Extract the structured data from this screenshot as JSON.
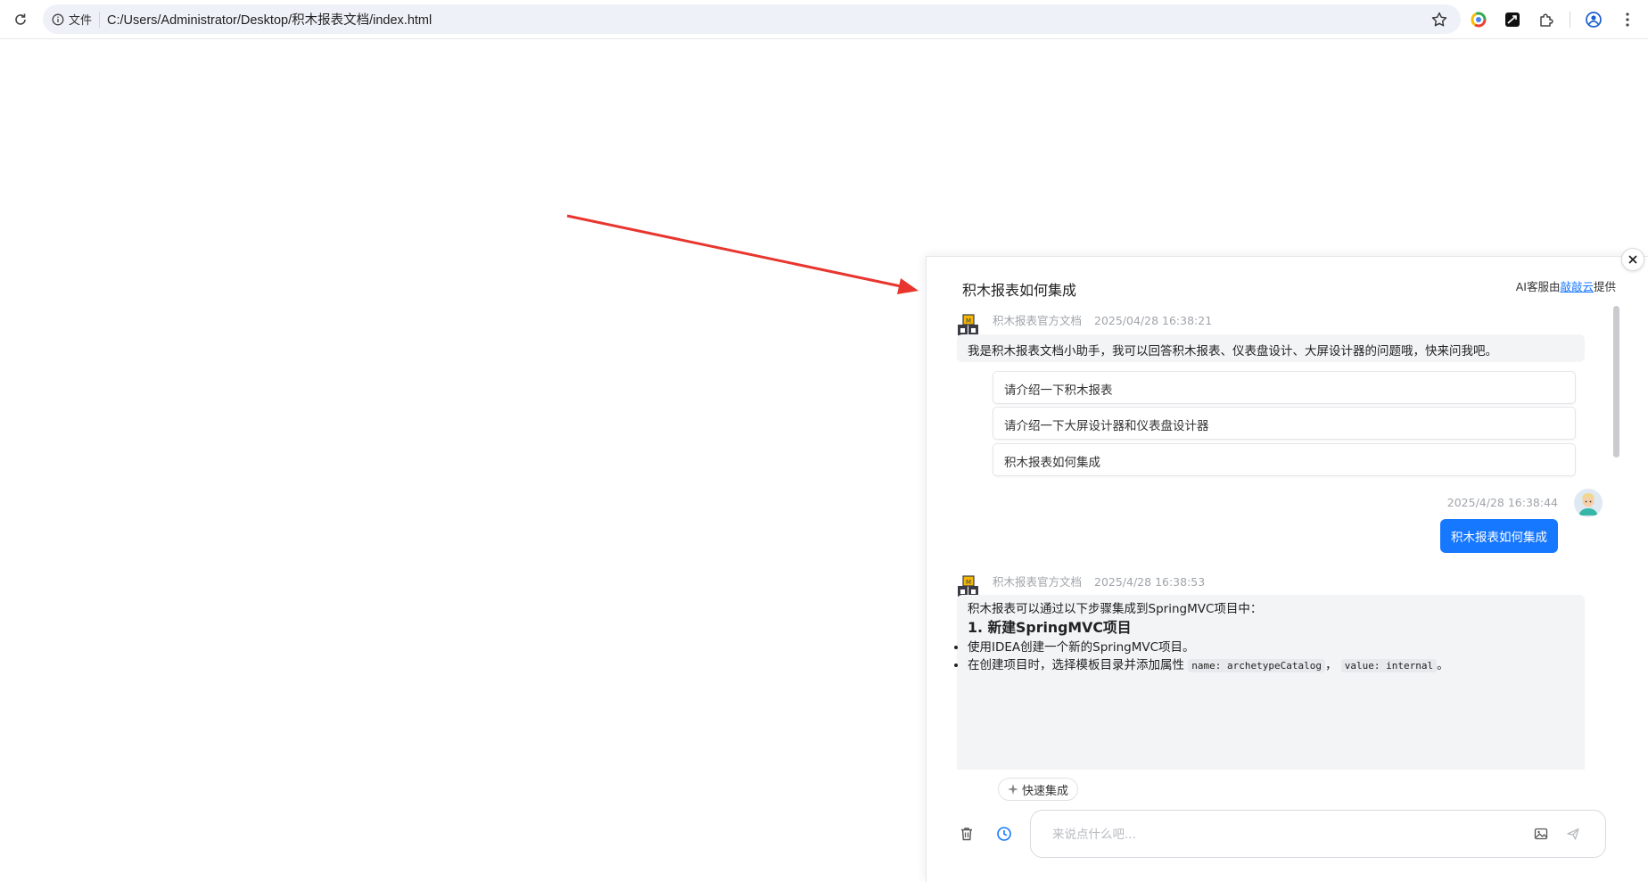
{
  "browser": {
    "site_chip": "文件",
    "url": "C:/Users/Administrator/Desktop/积木报表文档/index.html"
  },
  "chat": {
    "title": "积木报表如何集成",
    "provider_prefix": "AI客服由",
    "provider_link": "敲敲云",
    "provider_suffix": "提供",
    "welcome": {
      "sender": "积木报表官方文档",
      "time": "2025/04/28 16:38:21",
      "text": "我是积木报表文档小助手，我可以回答积木报表、仪表盘设计、大屏设计器的问题哦，快来问我吧。",
      "suggestions": [
        "请介绍一下积木报表",
        "请介绍一下大屏设计器和仪表盘设计器",
        "积木报表如何集成"
      ]
    },
    "user_message": {
      "time": "2025/4/28 16:38:44",
      "text": "积木报表如何集成"
    },
    "answer": {
      "sender": "积木报表官方文档",
      "time": "2025/4/28 16:38:53",
      "intro": "积木报表可以通过以下步骤集成到SpringMVC项目中：",
      "heading": "1. 新建SpringMVC项目",
      "bullet1": "使用IDEA创建一个新的SpringMVC项目。",
      "bullet2_text": "在创建项目时，选择模板目录并添加属性",
      "bullet2_code1": "name: archetypeCatalog",
      "bullet2_sep": "，",
      "bullet2_code2": "value: internal",
      "bullet2_end": "。"
    },
    "quick_button": "快速集成",
    "input_placeholder": "来说点什么吧..."
  }
}
